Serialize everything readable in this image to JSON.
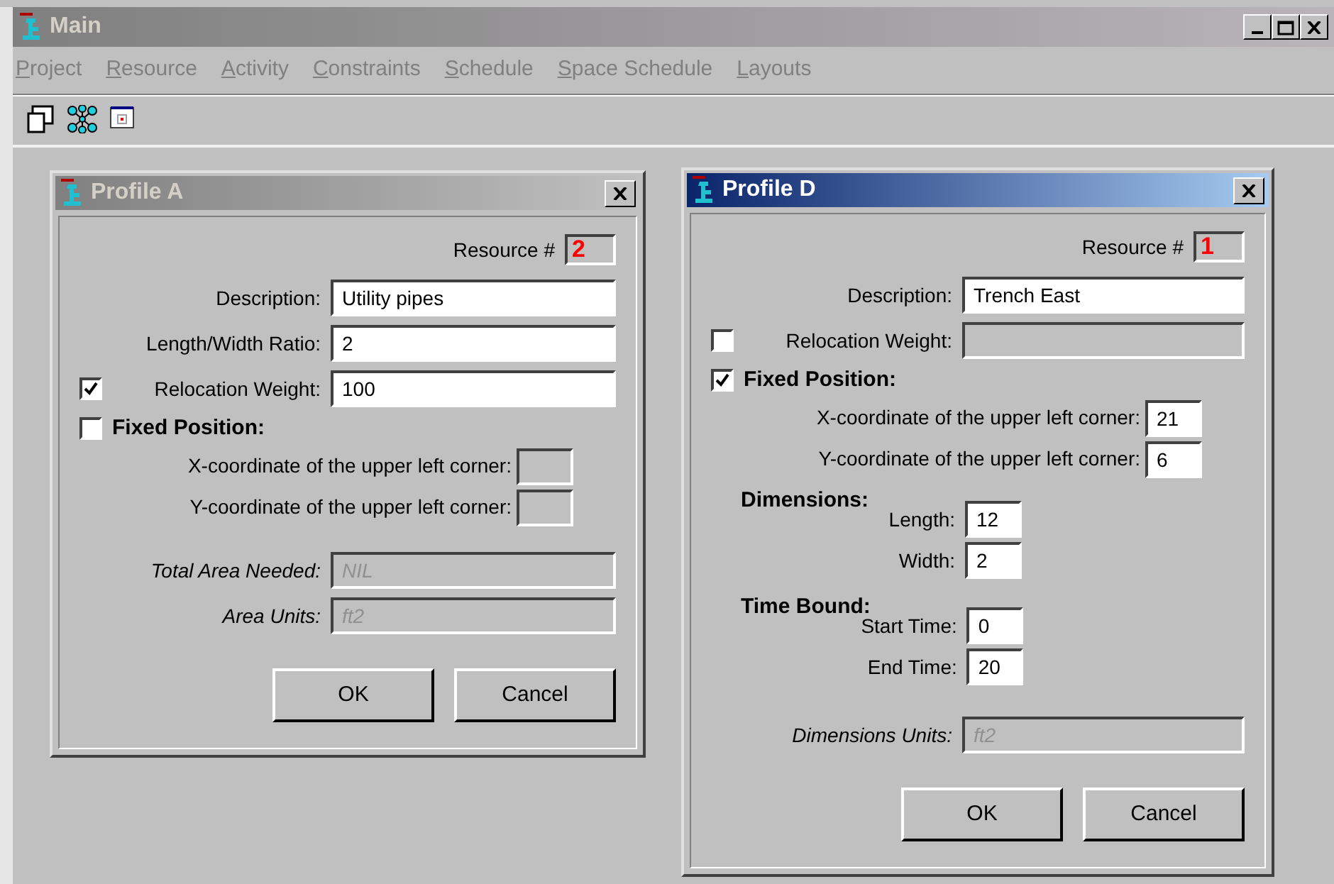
{
  "window": {
    "title": "Main"
  },
  "menu": [
    "Project",
    "Resource",
    "Activity",
    "Constraints",
    "Schedule",
    "Space Schedule",
    "Layouts"
  ],
  "dialogs": [
    {
      "title": "Profile A",
      "active": false,
      "resource_label": "Resource #",
      "resource_number": "2",
      "rows": [
        {
          "kind": "text",
          "label": "Description:",
          "value": "Utility pipes"
        },
        {
          "kind": "text",
          "label": "Length/Width Ratio:",
          "value": "2"
        },
        {
          "kind": "check_text",
          "label": "Relocation Weight:",
          "checked": true,
          "value": "100"
        },
        {
          "kind": "check_heading",
          "label": "Fixed Position:",
          "checked": false
        },
        {
          "kind": "coord",
          "label": "X-coordinate of the upper left corner:",
          "disabled": true
        },
        {
          "kind": "coord",
          "label": "Y-coordinate of the upper left corner:",
          "disabled": true
        },
        {
          "kind": "readonly",
          "label": "Total Area Needed:",
          "value": "NIL"
        },
        {
          "kind": "readonly",
          "label": "Area Units:",
          "value": "ft2"
        }
      ],
      "buttons": [
        "OK",
        "Cancel"
      ]
    },
    {
      "title": "Profile D",
      "active": true,
      "resource_label": "Resource #",
      "resource_number": "1",
      "rows": [
        {
          "kind": "text",
          "label": "Description:",
          "value": "Trench East"
        },
        {
          "kind": "check_text",
          "label": "Relocation Weight:",
          "checked": false
        },
        {
          "kind": "check_heading",
          "label": "Fixed Position:",
          "checked": true
        },
        {
          "kind": "coord",
          "label": "X-coordinate of the upper left corner:",
          "value": "21",
          "disabled": false
        },
        {
          "kind": "coord",
          "label": "Y-coordinate of the upper left corner:",
          "value": "6",
          "disabled": false
        },
        {
          "kind": "group",
          "label": "Dimensions:",
          "fields": [
            {
              "label": "Length:",
              "value": "12"
            },
            {
              "label": "Width:",
              "value": "2"
            }
          ]
        },
        {
          "kind": "group",
          "label": "Time Bound:",
          "fields": [
            {
              "label": "Start Time:",
              "value": "0"
            },
            {
              "label": "End Time:",
              "value": "20"
            }
          ]
        },
        {
          "kind": "readonly",
          "label": "Dimensions Units:",
          "value": "ft2"
        }
      ],
      "buttons": [
        "OK",
        "Cancel"
      ]
    }
  ]
}
